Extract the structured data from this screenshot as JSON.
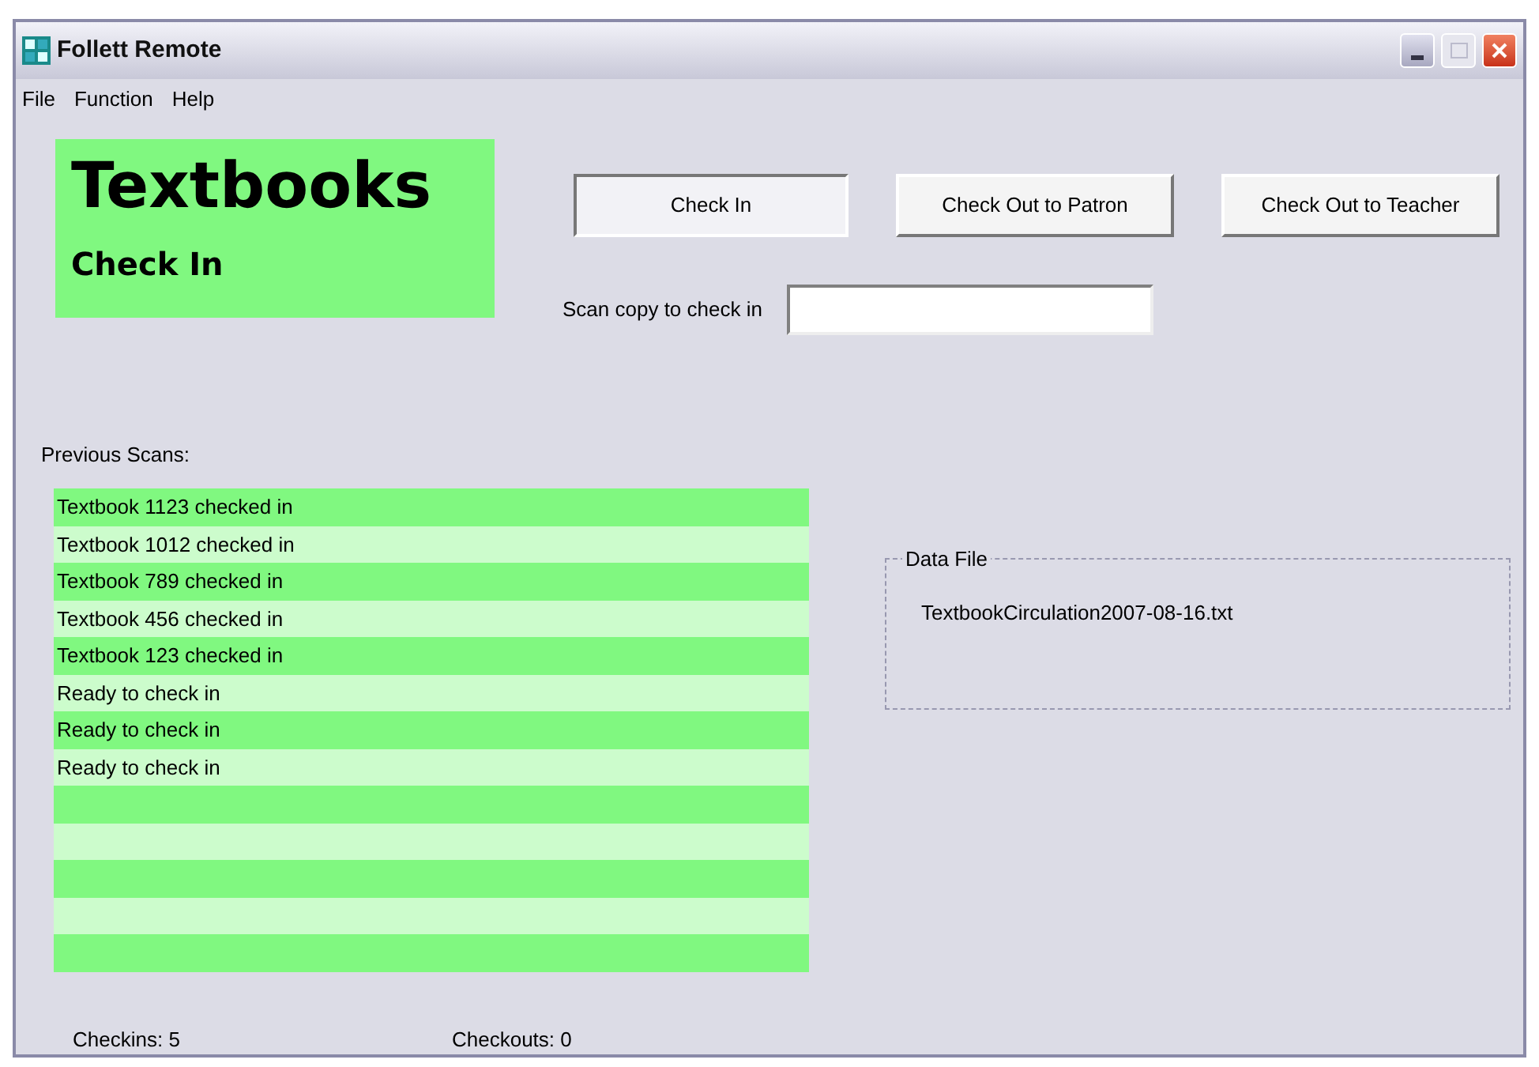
{
  "window": {
    "title": "Follett Remote"
  },
  "menu": [
    {
      "label": "File"
    },
    {
      "label": "Function"
    },
    {
      "label": "Help"
    }
  ],
  "header": {
    "title": "Textbooks",
    "subtitle": "Check In"
  },
  "modes": [
    {
      "label": "Check In",
      "selected": true
    },
    {
      "label": "Check Out to Patron",
      "selected": false
    },
    {
      "label": "Check Out to Teacher",
      "selected": false
    }
  ],
  "scan": {
    "label": "Scan copy to check in"
  },
  "previous_scans": {
    "label": "Previous Scans:",
    "rows": [
      "Textbook 1123 checked in",
      "Textbook 1012 checked in",
      "Textbook 789 checked in",
      "Textbook 456 checked in",
      "Textbook 123 checked in",
      "Ready to check in",
      "Ready to check in",
      "Ready to check in"
    ]
  },
  "data_file": {
    "legend": "Data File",
    "value": "TextbookCirculation2007-08-16.txt"
  },
  "status": [
    {
      "label": "Checkins: 5"
    },
    {
      "label": "Checkouts: 0"
    }
  ]
}
